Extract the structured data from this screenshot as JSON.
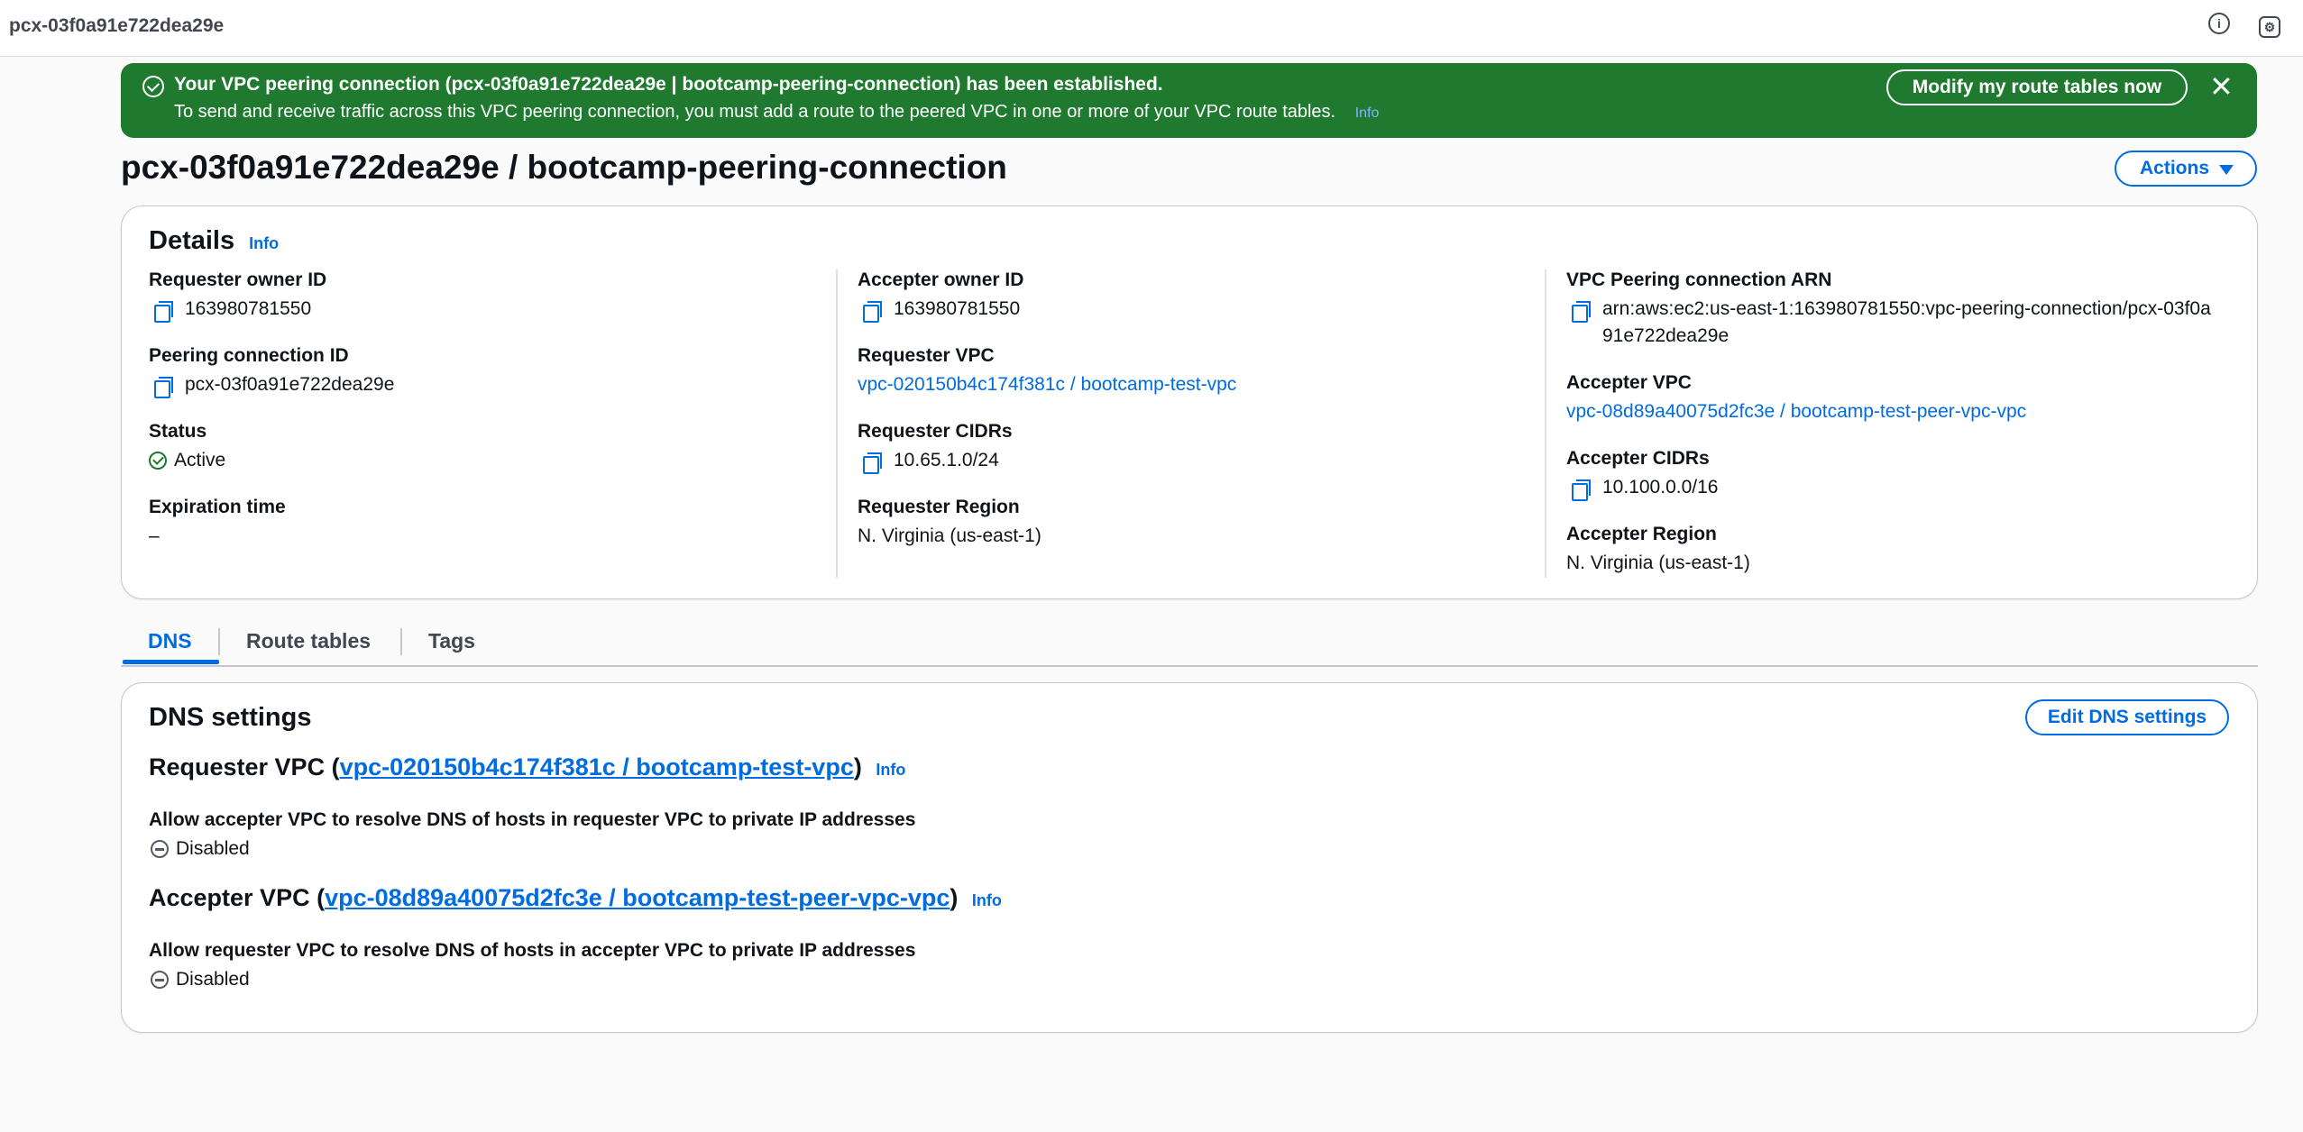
{
  "topbar": {
    "breadcrumb": "pcx-03f0a91e722dea29e",
    "icons": [
      "info-icon",
      "settings-icon"
    ]
  },
  "flash": {
    "title": "Your VPC peering connection (pcx-03f0a91e722dea29e | bootcamp-peering-connection) has been established.",
    "message": "To send and receive traffic across this VPC peering connection, you must add a route to the peered VPC in one or more of your VPC route tables.",
    "info_label": "Info",
    "action_label": "Modify my route tables now",
    "close_glyph": "✕",
    "color": "#1f7a30"
  },
  "page": {
    "title": "pcx-03f0a91e722dea29e / bootcamp-peering-connection",
    "actions_label": "Actions"
  },
  "details": {
    "heading": "Details",
    "info_label": "Info",
    "requester_owner_id": {
      "label": "Requester owner ID",
      "value": "163980781550"
    },
    "peering_connection_id": {
      "label": "Peering connection ID",
      "value": "pcx-03f0a91e722dea29e"
    },
    "status": {
      "label": "Status",
      "value": "Active"
    },
    "expiration_time": {
      "label": "Expiration time",
      "value": "–"
    },
    "accepter_owner_id": {
      "label": "Accepter owner ID",
      "value": "163980781550"
    },
    "requester_vpc": {
      "label": "Requester VPC",
      "value": "vpc-020150b4c174f381c / bootcamp-test-vpc"
    },
    "requester_cidrs": {
      "label": "Requester CIDRs",
      "value": "10.65.1.0/24"
    },
    "requester_region": {
      "label": "Requester Region",
      "value": "N. Virginia (us-east-1)"
    },
    "arn": {
      "label": "VPC Peering connection ARN",
      "line1": "arn:aws:ec2:us-east-1:163980781550:vpc-peering-connection/pcx-03f0a",
      "line2": "91e722dea29e"
    },
    "accepter_vpc": {
      "label": "Accepter VPC",
      "value": "vpc-08d89a40075d2fc3e / bootcamp-test-peer-vpc-vpc"
    },
    "accepter_cidrs": {
      "label": "Accepter CIDRs",
      "value": "10.100.0.0/16"
    },
    "accepter_region": {
      "label": "Accepter Region",
      "value": "N. Virginia (us-east-1)"
    }
  },
  "tabs": [
    {
      "label": "DNS"
    },
    {
      "label": "Route tables"
    },
    {
      "label": "Tags"
    }
  ],
  "dns": {
    "heading": "DNS settings",
    "edit_label": "Edit DNS settings",
    "requester": {
      "prefix": "Requester VPC (",
      "vpc": "vpc-020150b4c174f381c / bootcamp-test-vpc",
      "suffix": ")",
      "info_label": "Info",
      "setting_label": "Allow accepter VPC to resolve DNS of hosts in requester VPC to private IP addresses",
      "setting_value": "Disabled"
    },
    "accepter": {
      "prefix": "Accepter VPC (",
      "vpc": "vpc-08d89a40075d2fc3e / bootcamp-test-peer-vpc-vpc",
      "suffix": ")",
      "info_label": "Info",
      "setting_label": "Allow requester VPC to resolve DNS of hosts in accepter VPC to private IP addresses",
      "setting_value": "Disabled"
    }
  }
}
